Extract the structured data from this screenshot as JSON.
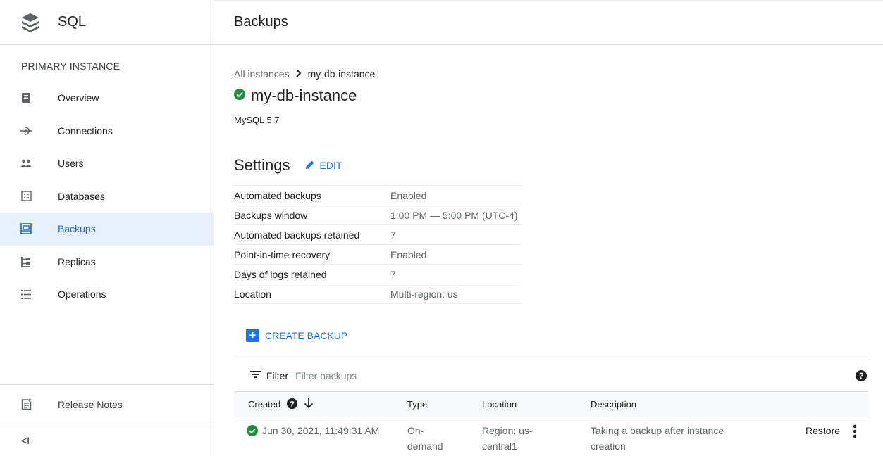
{
  "app": {
    "title": "SQL",
    "icon": "layers-icon"
  },
  "sidebar": {
    "section_title": "PRIMARY INSTANCE",
    "items": [
      {
        "label": "Overview",
        "icon": "overview-icon",
        "active": false
      },
      {
        "label": "Connections",
        "icon": "connections-icon",
        "active": false
      },
      {
        "label": "Users",
        "icon": "users-icon",
        "active": false
      },
      {
        "label": "Databases",
        "icon": "databases-icon",
        "active": false
      },
      {
        "label": "Backups",
        "icon": "backups-icon",
        "active": true
      },
      {
        "label": "Replicas",
        "icon": "replicas-icon",
        "active": false
      },
      {
        "label": "Operations",
        "icon": "operations-icon",
        "active": false
      }
    ],
    "release_notes": "Release Notes",
    "collapse": "<I"
  },
  "header": {
    "title": "Backups"
  },
  "breadcrumb": {
    "parent": "All instances",
    "separator": ">",
    "current": "my-db-instance"
  },
  "instance": {
    "name": "my-db-instance",
    "version": "MySQL 5.7",
    "status_color": "#1e8e3e"
  },
  "settings": {
    "title": "Settings",
    "edit_label": "EDIT",
    "rows": [
      {
        "key": "Automated backups",
        "value": "Enabled"
      },
      {
        "key": "Backups window",
        "value": "1:00 PM — 5:00 PM (UTC-4)"
      },
      {
        "key": "Automated backups retained",
        "value": "7"
      },
      {
        "key": "Point-in-time recovery",
        "value": "Enabled"
      },
      {
        "key": "Days of logs retained",
        "value": "7"
      },
      {
        "key": "Location",
        "value": "Multi-region: us"
      }
    ]
  },
  "create_backup_label": "CREATE BACKUP",
  "filter": {
    "label": "Filter",
    "placeholder": "Filter backups"
  },
  "backups_table": {
    "columns": {
      "created": "Created",
      "type": "Type",
      "location": "Location",
      "description": "Description"
    },
    "rows": [
      {
        "created": "Jun 30, 2021, 11:49:31 AM",
        "type": "On-demand",
        "location": "Region: us-central1",
        "description": "Taking a backup after instance creation",
        "action": "Restore"
      }
    ]
  },
  "colors": {
    "accent": "#1a73e8",
    "active_bg": "#e8f0fe",
    "success": "#1e8e3e"
  }
}
